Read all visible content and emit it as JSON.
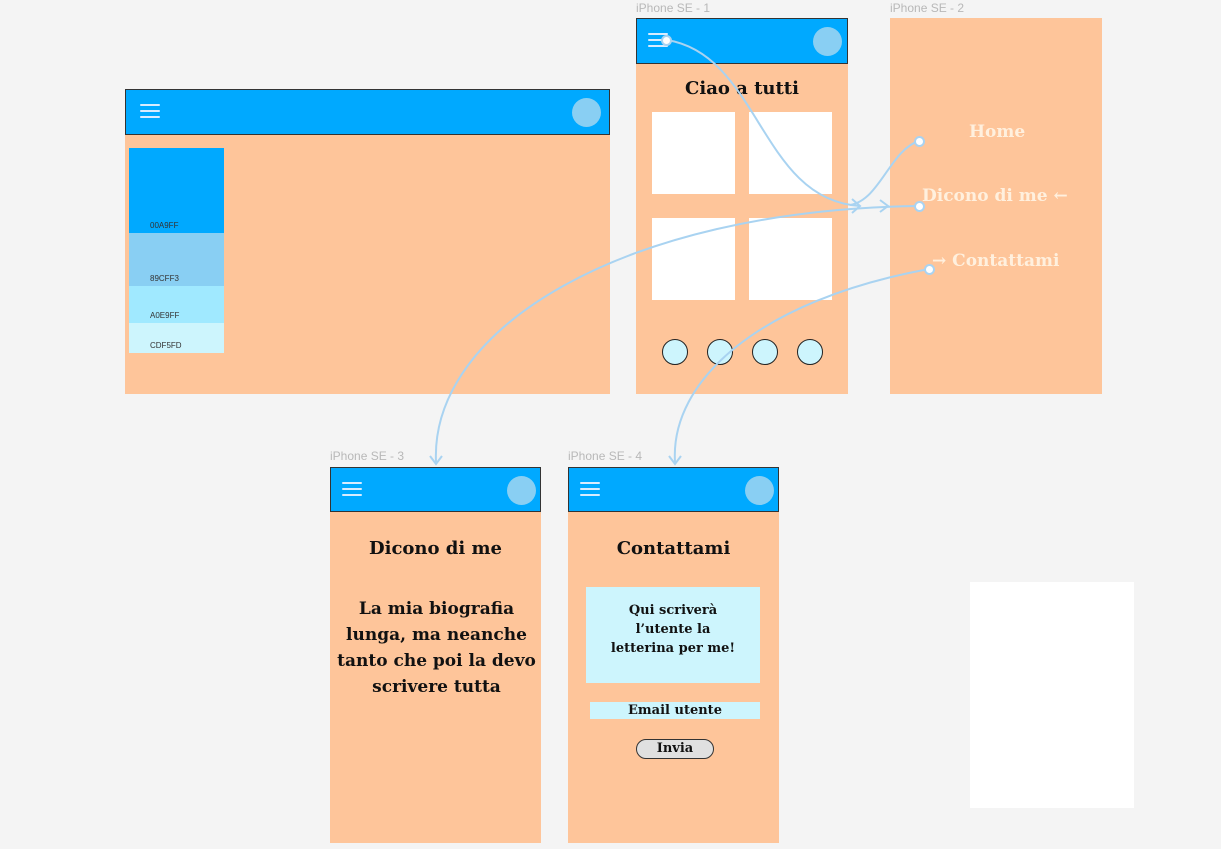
{
  "artboards": {
    "iphone1": "iPhone SE - 1",
    "iphone2": "iPhone SE - 2",
    "iphone3": "iPhone SE - 3",
    "iphone4": "iPhone SE - 4"
  },
  "palette": [
    {
      "hex": "00A9FF",
      "color": "#00a9ff"
    },
    {
      "hex": "89CFF3",
      "color": "#89cff3"
    },
    {
      "hex": "A0E9FF",
      "color": "#a0e9ff"
    },
    {
      "hex": "CDF5FD",
      "color": "#cdf5fd"
    }
  ],
  "home": {
    "title": "Ciao a tutti"
  },
  "menu": {
    "home": "Home",
    "about": "Dicono di me ←",
    "contact": "→ Contattami"
  },
  "about": {
    "title": "Dicono di me",
    "body": "La mia biografia lunga, ma neanche tanto che poi la devo scrivere tutta"
  },
  "contact": {
    "title": "Contattami",
    "message_placeholder": "Qui scriverà l’utente la letterina per me!",
    "email_placeholder": "Email utente",
    "send": "Invia"
  },
  "colors": {
    "header": "#00a9ff",
    "board": "#fec59a",
    "wire": "#a9d3f1",
    "canvas": "#f4f4f4"
  }
}
